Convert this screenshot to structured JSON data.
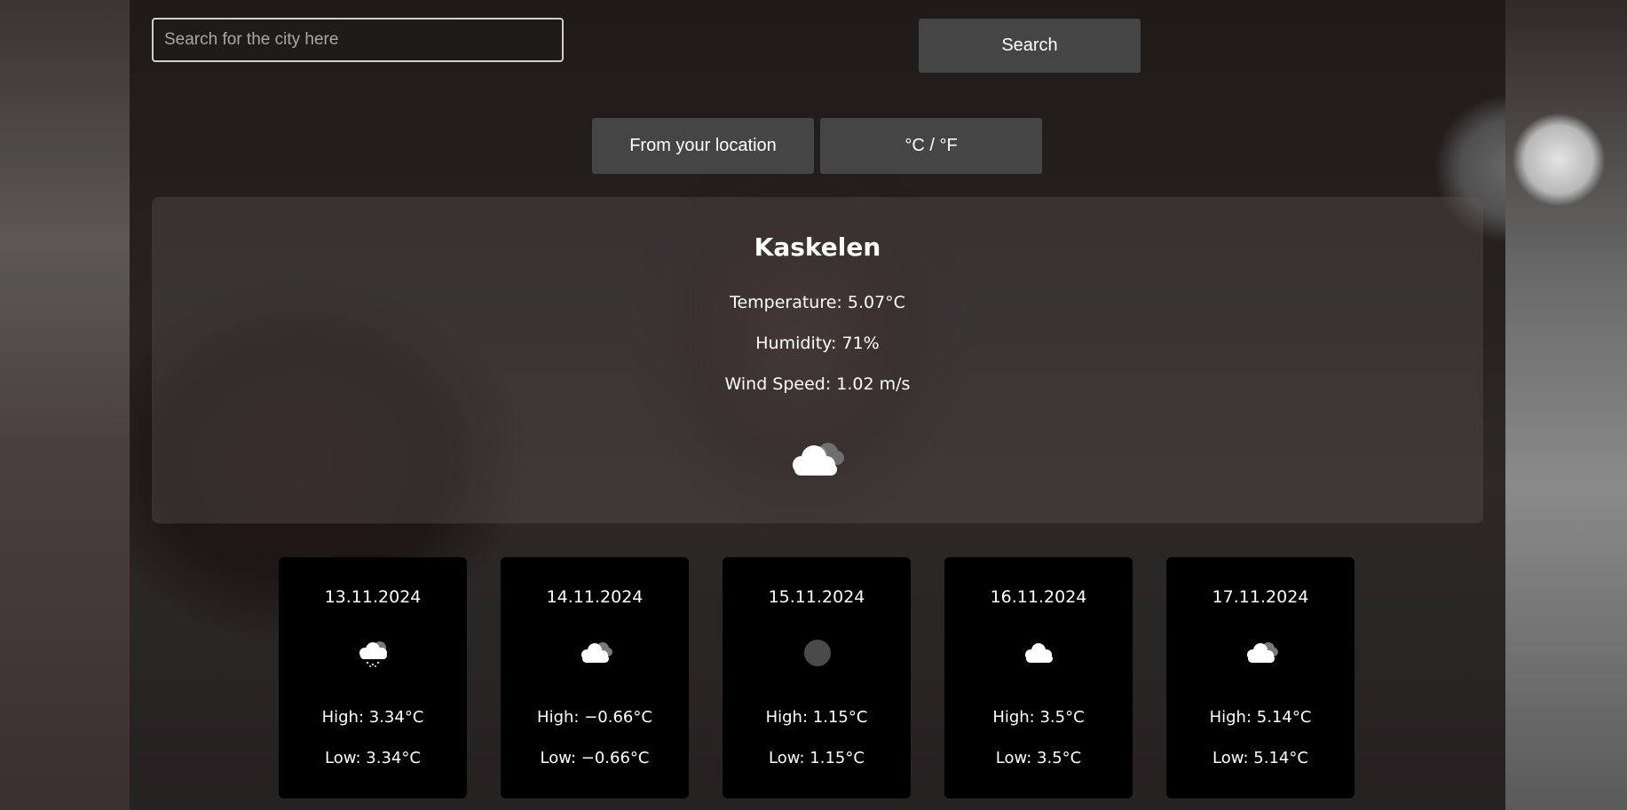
{
  "search": {
    "placeholder": "Search for the city here",
    "value": "",
    "button_label": "Search"
  },
  "controls": {
    "location_label": "From your location",
    "units_label": "°C / °F"
  },
  "current": {
    "city": "Kaskelen",
    "temperature": "Temperature: 5.07°C",
    "humidity": "Humidity: 71%",
    "wind": "Wind Speed: 1.02 m/s",
    "icon": "overcast-cloud-icon"
  },
  "forecast": [
    {
      "date": "13.11.2024",
      "icon": "cloud-snow-icon",
      "high": "High: 3.34°C",
      "low": "Low: 3.34°C"
    },
    {
      "date": "14.11.2024",
      "icon": "overcast-cloud-icon",
      "high": "High: −0.66°C",
      "low": "Low: −0.66°C"
    },
    {
      "date": "15.11.2024",
      "icon": "unknown-weather-icon",
      "high": "High: 1.15°C",
      "low": "Low: 1.15°C"
    },
    {
      "date": "16.11.2024",
      "icon": "cloud-icon",
      "high": "High: 3.5°C",
      "low": "Low: 3.5°C"
    },
    {
      "date": "17.11.2024",
      "icon": "overcast-cloud-icon",
      "high": "High: 5.14°C",
      "low": "Low: 5.14°C"
    }
  ],
  "colors": {
    "button_bg": "#454545",
    "forecast_card_bg": "#000000",
    "text": "#ffffff"
  }
}
